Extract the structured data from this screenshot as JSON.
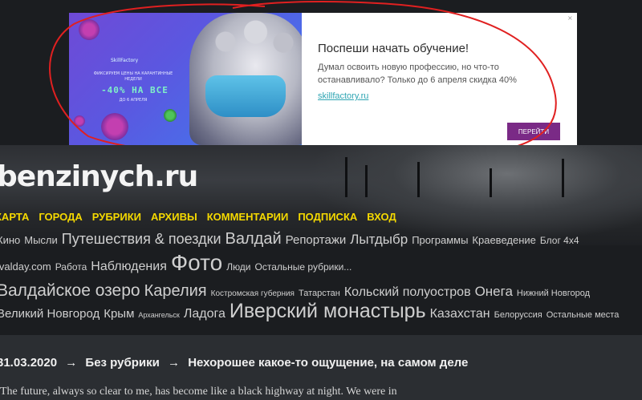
{
  "ad": {
    "logo": "SkillFactory",
    "promo_small": "Фиксируем цены на карантинные недели",
    "promo_big": "-40% НА ВСЕ",
    "promo_date": "до 6 апреля",
    "title": "Поспеши начать обучение!",
    "text": "Думал освоить новую профессию, но что-то останавливало? Только до 6 апреля скидка 40%",
    "link": "skillfactory.ru",
    "button": "ПЕРЕЙТИ",
    "close": "×"
  },
  "annotation_color": "#e02020",
  "site": {
    "title": "benzinych.ru"
  },
  "nav": [
    "КАРТА",
    "ГОРОДА",
    "РУБРИКИ",
    "АРХИВЫ",
    "КОММЕНТАРИИ",
    "ПОДПИСКА",
    "ВХОД"
  ],
  "nav_color": "#f5d900",
  "tag_cloud_1": [
    {
      "label": "Кино",
      "size": 13
    },
    {
      "label": "Мысли",
      "size": 13
    },
    {
      "label": "Путешествия & поездки",
      "size": 18
    },
    {
      "label": "Валдай",
      "size": 20
    },
    {
      "label": "Репортажи",
      "size": 15
    },
    {
      "label": "Лытдыбр",
      "size": 17
    },
    {
      "label": "Программы",
      "size": 13
    },
    {
      "label": "Краеведение",
      "size": 13
    },
    {
      "label": "Блог 4x4",
      "size": 12
    }
  ],
  "tag_cloud_2": [
    {
      "label": "ivalday.com",
      "size": 13
    },
    {
      "label": "Работа",
      "size": 12
    },
    {
      "label": "Наблюдения",
      "size": 16
    },
    {
      "label": "Фото",
      "size": 28
    },
    {
      "label": "Люди",
      "size": 12
    },
    {
      "label": "Остальные рубрики...",
      "size": 12
    }
  ],
  "tag_cloud_3": [
    {
      "label": "Валдайское озеро",
      "size": 21
    },
    {
      "label": "Карелия",
      "size": 20
    },
    {
      "label": "Костромская губерния",
      "size": 10
    },
    {
      "label": "Татарстан",
      "size": 11
    },
    {
      "label": "Кольский полуостров",
      "size": 16
    },
    {
      "label": "Онега",
      "size": 17
    },
    {
      "label": "Нижний Новгород",
      "size": 11
    }
  ],
  "tag_cloud_4": [
    {
      "label": "Великий Новгород",
      "size": 15
    },
    {
      "label": "Крым",
      "size": 15
    },
    {
      "label": "Архангельск",
      "size": 9
    },
    {
      "label": "Ладога",
      "size": 16
    },
    {
      "label": "Иверский монастырь",
      "size": 25
    },
    {
      "label": "Казахстан",
      "size": 16
    },
    {
      "label": "Белоруссия",
      "size": 11
    },
    {
      "label": "Остальные места",
      "size": 11
    }
  ],
  "post": {
    "date": "31.03.2020",
    "arrow": "→",
    "category": "Без рубрики",
    "title": "Нехорошее какое-то ощущение, на самом деле",
    "excerpt": "The future, always so clear to me, has become like a black highway at night. We were in"
  }
}
